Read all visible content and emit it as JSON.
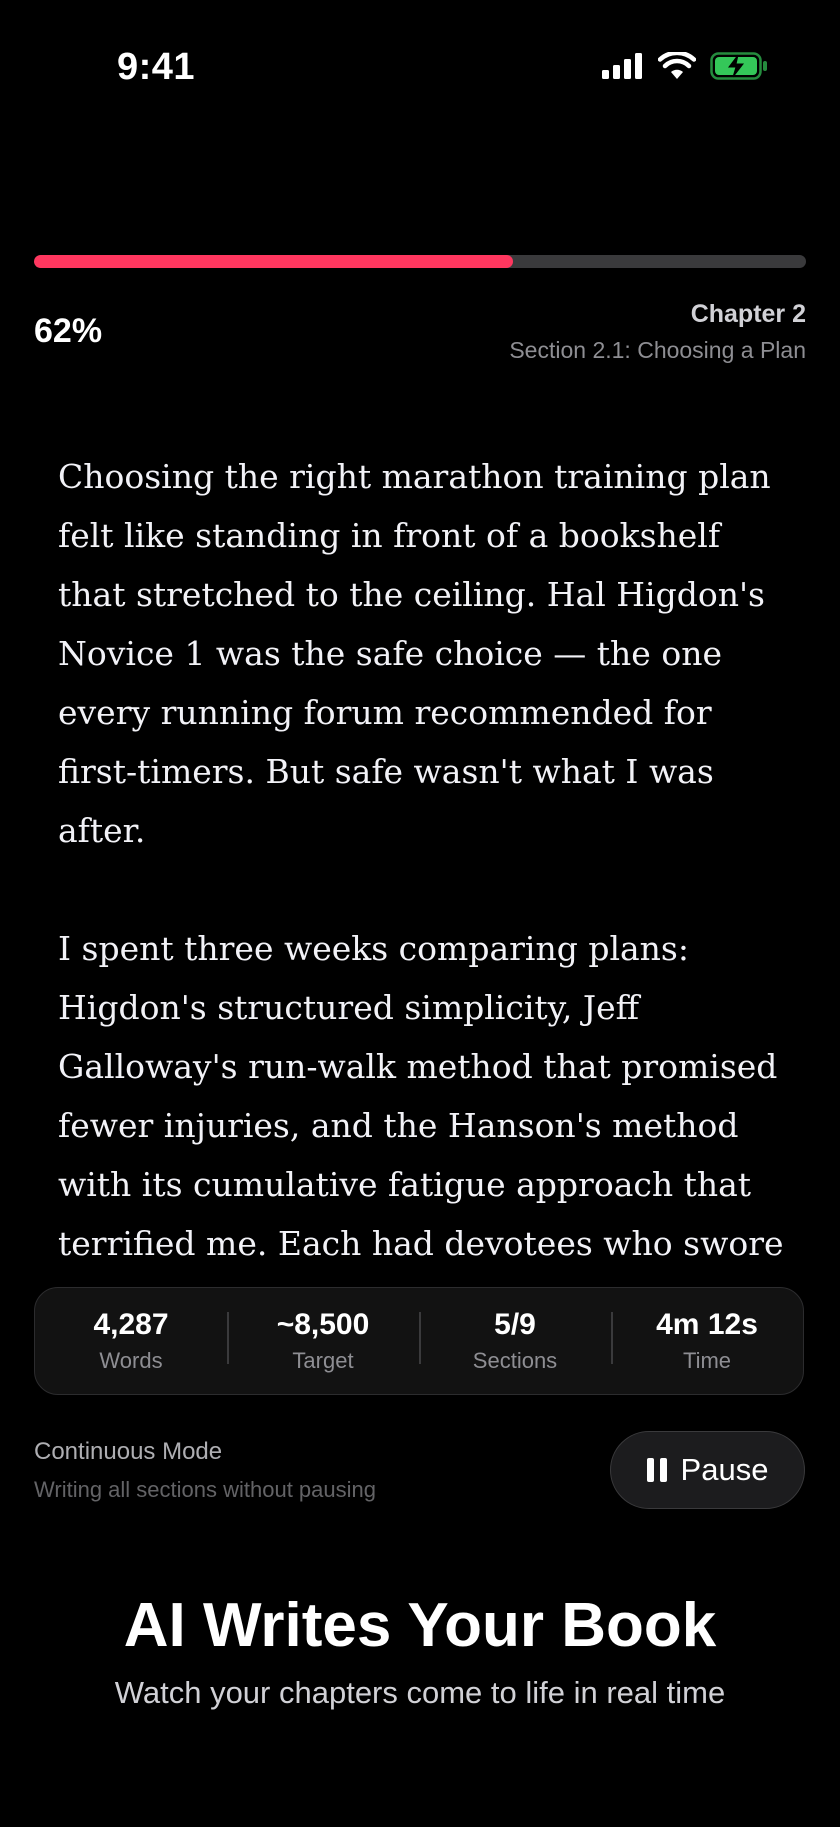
{
  "status_bar": {
    "time": "9:41",
    "icons": [
      "cellular-signal-icon",
      "wifi-icon",
      "battery-charging-icon"
    ],
    "battery_color": "#34c759"
  },
  "progress": {
    "percent_label": "62%",
    "fraction": 0.62,
    "fill_color": "#ff375f"
  },
  "chapter": {
    "title": "Chapter 2",
    "section": "Section 2.1: Choosing a Plan"
  },
  "content": {
    "paragraphs": [
      "Choosing the right marathon training plan felt like standing in front of a bookshelf that stretched to the ceiling. Hal Higdon's Novice 1 was the safe choice — the one every running forum recommended for first-timers. But safe wasn't what I was after.",
      "I spent three weeks comparing plans: Higdon's structured simplicity, Jeff Galloway's run-walk method that promised fewer injuries, and the Hanson's method with its cumulative fatigue approach that terrified me. Each had devotees who swore it was the only way."
    ]
  },
  "stats": [
    {
      "value": "4,287",
      "label": "Words"
    },
    {
      "value": "~8,500",
      "label": "Target"
    },
    {
      "value": "5/9",
      "label": "Sections"
    },
    {
      "value": "4m 12s",
      "label": "Time"
    }
  ],
  "mode": {
    "title": "Continuous Mode",
    "subtitle": "Writing all sections without pausing"
  },
  "pause_button": {
    "label": "Pause",
    "icon": "pause-icon"
  },
  "hero": {
    "title": "AI Writes Your Book",
    "subtitle": "Watch your chapters come to life in real time"
  }
}
